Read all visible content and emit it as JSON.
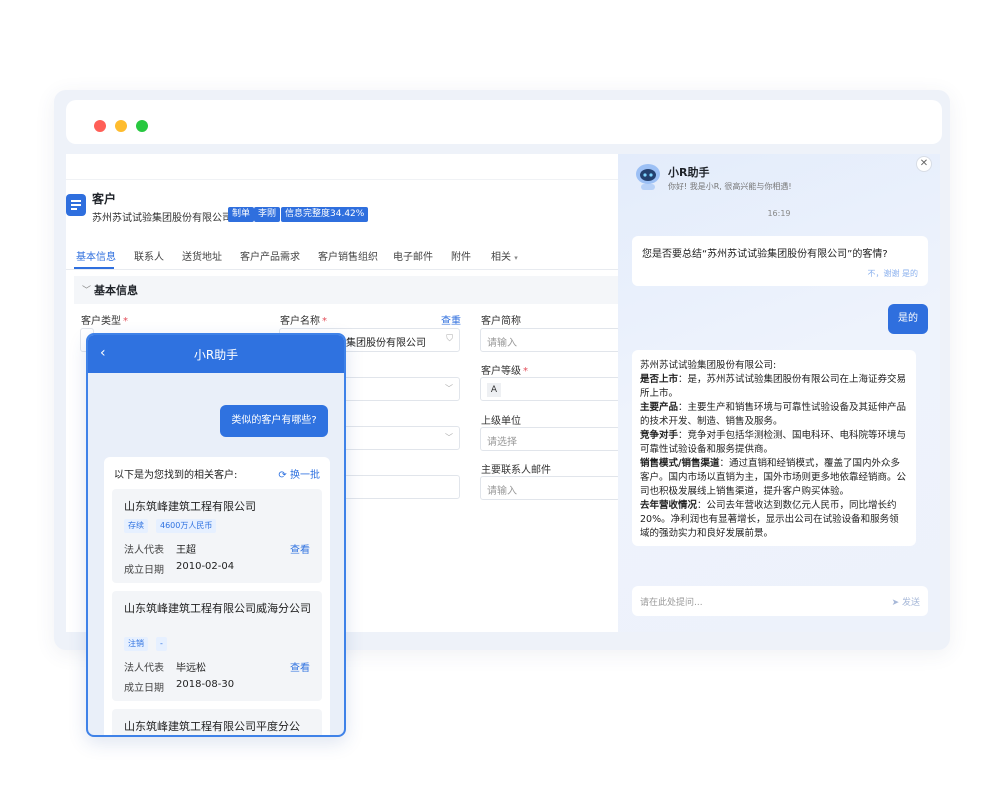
{
  "window": {
    "controls": [
      "close",
      "minimize",
      "maximize"
    ]
  },
  "crm": {
    "title": "客户",
    "company": "苏州苏试试验集团股份有限公司",
    "badges": [
      "制单",
      "李刚",
      "信息完整度34.42%"
    ],
    "tabs": [
      "基本信息",
      "联系人",
      "送货地址",
      "客户产品需求",
      "客户销售组织",
      "电子邮件",
      "附件",
      "相关"
    ],
    "section_title": "基本信息",
    "lookup_link": "查重",
    "fields": {
      "customer_type": "客户类型",
      "customer_name": "客户名称",
      "customer_name_value": "苏州苏试试验集团股份有限公司",
      "short_name": "客户简称",
      "short_name_placeholder": "请输入",
      "level": "客户等级",
      "level_value": "A",
      "parent": "上级单位",
      "parent_placeholder": "请选择",
      "contact_email": "主要联系人邮件",
      "contact_email_placeholder": "请输入"
    }
  },
  "assistant": {
    "title": "小R助手",
    "greeting": "你好! 我是小R, 很高兴能与你相遇!",
    "time": "16:19",
    "question": "您是否要总结“苏州苏试试验集团股份有限公司”的客情?",
    "actions": "不，谢谢   是的",
    "user_reply": "是的",
    "answer_intro": "苏州苏试试验集团股份有限公司:",
    "answer_items": [
      {
        "label": "是否上市",
        "text": "是，苏州苏试试验集团股份有限公司在上海证券交易所上市。"
      },
      {
        "label": "主要产品",
        "text": "主要生产和销售环境与可靠性试验设备及其延伸产品的技术开发、制造、销售及服务。"
      },
      {
        "label": "竞争对手",
        "text": "竞争对手包括华测检测、国电科环、电科院等环境与可靠性试验设备和服务提供商。"
      },
      {
        "label": "销售模式/销售渠道",
        "text": "通过直销和经销模式，覆盖了国内外众多客户。国内市场以直销为主，国外市场则更多地依靠经销商。公司也积极发展线上销售渠道，提升客户购买体验。"
      },
      {
        "label": "去年营收情况",
        "text": "公司去年营收达到数亿元人民币，同比增长约20%。净利润也有显著增长，显示出公司在试验设备和服务领域的强劲实力和良好发展前景。"
      }
    ],
    "input_placeholder": "请在此处提问...",
    "send_label": "发送"
  },
  "mobile": {
    "title": "小R助手",
    "user_question": "类似的客户有哪些?",
    "results_header": "以下是为您找到的相关客户:",
    "refresh_label": "换一批",
    "results": [
      {
        "name": "山东筑峰建筑工程有限公司",
        "status": "存续",
        "capital": "4600万人民币",
        "rep_label": "法人代表",
        "rep": "王超",
        "date_label": "成立日期",
        "date": "2010-02-04",
        "view": "查看"
      },
      {
        "name": "山东筑峰建筑工程有限公司威海分公司",
        "status": "注销",
        "capital": "-",
        "rep_label": "法人代表",
        "rep": "毕远松",
        "date_label": "成立日期",
        "date": "2018-08-30",
        "view": "查看"
      },
      {
        "name": "山东筑峰建筑工程有限公司平度分公"
      }
    ]
  },
  "colors": {
    "primary": "#2f6fde",
    "required": "#e34d59"
  }
}
